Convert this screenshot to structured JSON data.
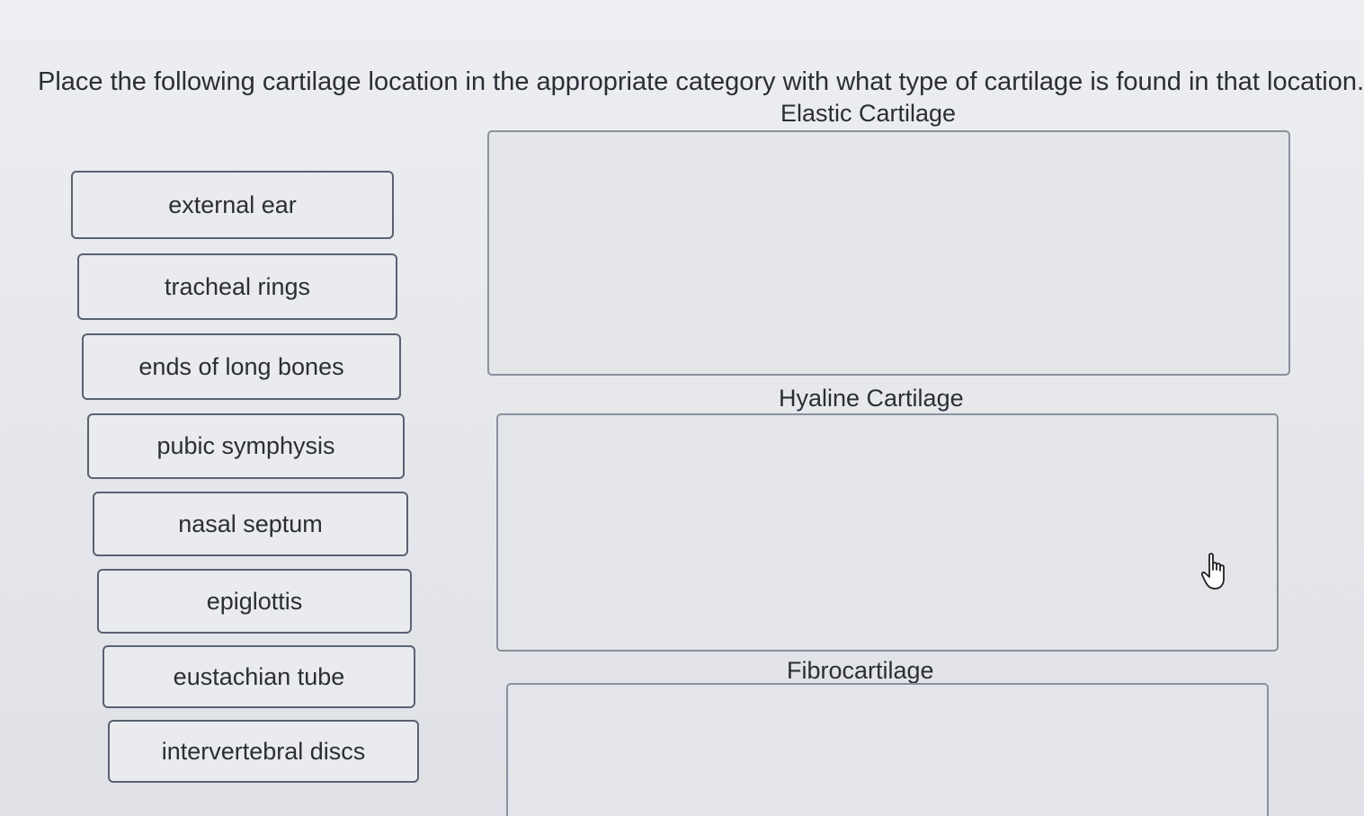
{
  "instructions": "Place the following cartilage location in the appropriate category with what type of cartilage is found in that location.",
  "items": [
    {
      "label": "external ear"
    },
    {
      "label": "tracheal rings"
    },
    {
      "label": "ends of long bones"
    },
    {
      "label": "pubic symphysis"
    },
    {
      "label": "nasal septum"
    },
    {
      "label": "epiglottis"
    },
    {
      "label": "eustachian tube"
    },
    {
      "label": "intervertebral discs"
    }
  ],
  "categories": [
    {
      "title": "Elastic Cartilage"
    },
    {
      "title": "Hyaline Cartilage"
    },
    {
      "title": "Fibrocartilage"
    }
  ],
  "cursor": {
    "icon": "hand-pointer-icon"
  }
}
